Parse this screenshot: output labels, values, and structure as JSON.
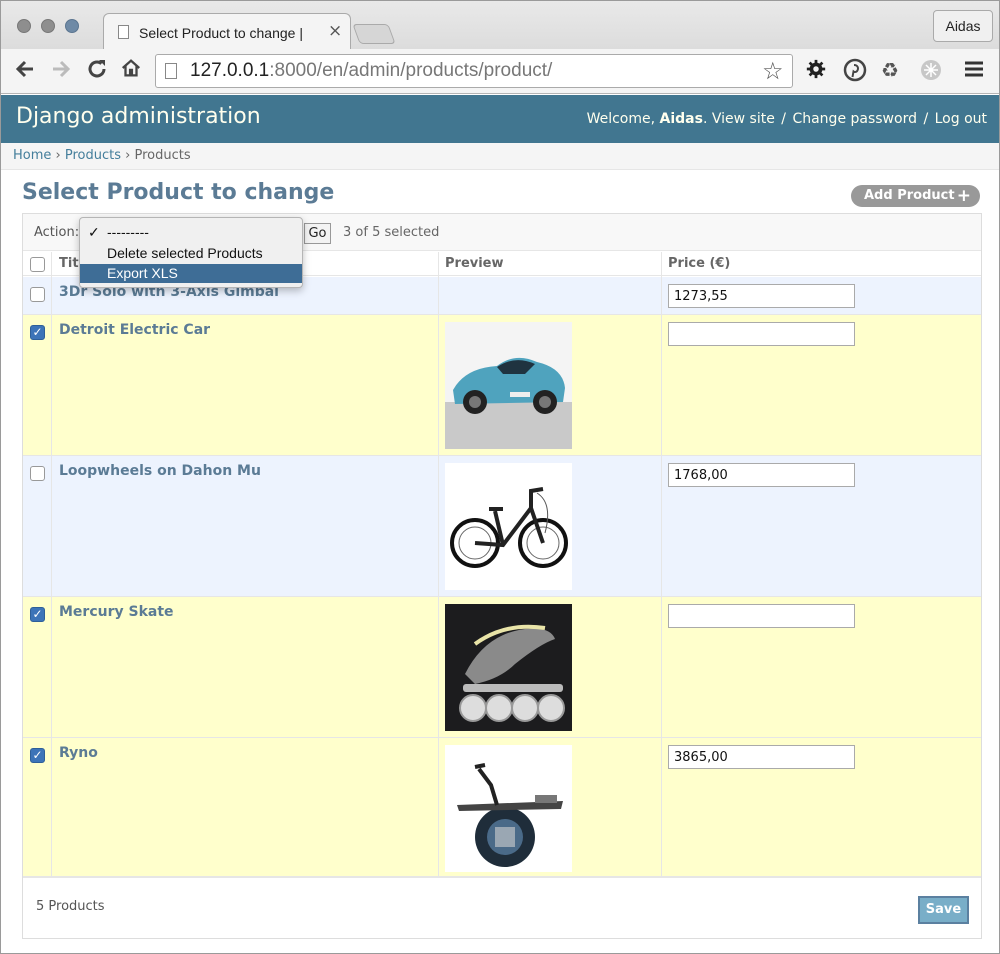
{
  "browser": {
    "tab_title": "Select Product to change |",
    "profile_name": "Aidas",
    "url_host": "127.0.0.1",
    "url_rest": ":8000/en/admin/products/product/"
  },
  "admin": {
    "site_name": "Django administration",
    "welcome": "Welcome,",
    "username": "Aidas",
    "view_site": "View site",
    "change_password": "Change password",
    "log_out": "Log out"
  },
  "breadcrumbs": {
    "home": "Home",
    "app": "Products",
    "current": "Products",
    "separator": "›"
  },
  "page": {
    "title": "Select Product to change",
    "add_button": "Add Product"
  },
  "actions": {
    "label": "Action:",
    "go": "Go",
    "selection_count": "3 of 5 selected",
    "options": [
      "---------",
      "Delete selected Products",
      "Export XLS"
    ],
    "checked_option": "---------",
    "highlighted_option": "Export XLS"
  },
  "table": {
    "headers": [
      "Title",
      "Preview",
      "Price (€)"
    ],
    "rows": [
      {
        "title": "3Dr Solo with 3-Axis Gimbal",
        "price": "1273,55",
        "selected": false,
        "preview": ""
      },
      {
        "title": "Detroit Electric Car",
        "price": "",
        "selected": true,
        "preview": "electric-car-image"
      },
      {
        "title": "Loopwheels on Dahon Mu",
        "price": "1768,00",
        "selected": false,
        "preview": "folding-bike-image"
      },
      {
        "title": "Mercury Skate",
        "price": "",
        "selected": true,
        "preview": "skate-image"
      },
      {
        "title": "Ryno",
        "price": "3865,00",
        "selected": true,
        "preview": "unicycle-image"
      }
    ]
  },
  "footer": {
    "count": "5 Products",
    "save": "Save"
  },
  "colors": {
    "header_bg": "#417690",
    "selected_row": "#ffffcc",
    "alt_row": "#edf3fe",
    "link": "#5b7b95"
  }
}
